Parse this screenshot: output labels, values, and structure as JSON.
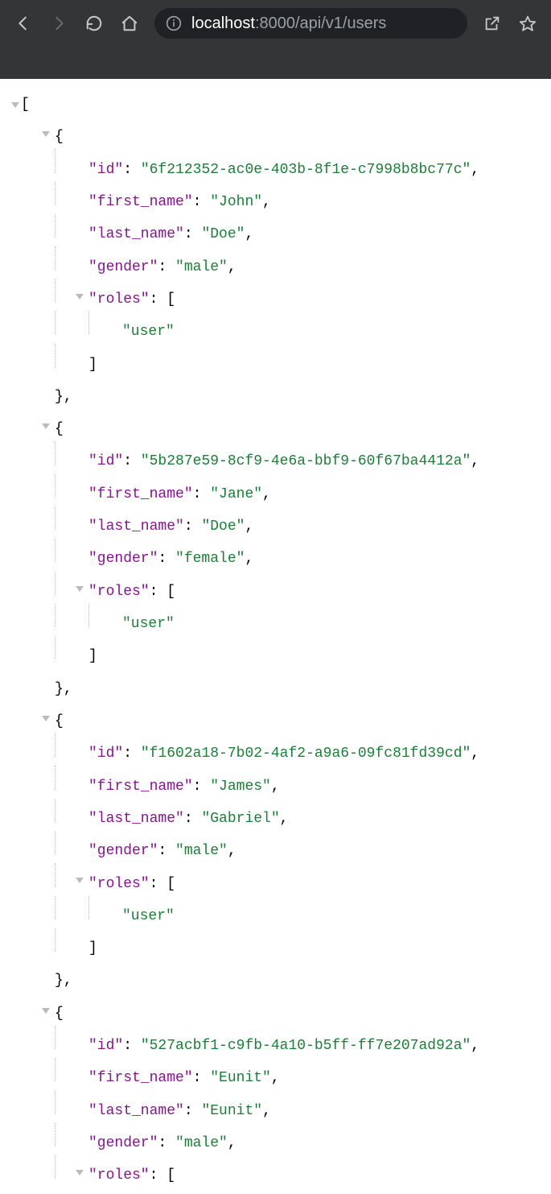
{
  "toolbar": {
    "url_host": "localhost",
    "url_port_path": ":8000/api/v1/users"
  },
  "json": {
    "users": [
      {
        "id": "6f212352-ac0e-403b-8f1e-c7998b8bc77c",
        "first_name": "John",
        "last_name": "Doe",
        "gender": "male",
        "roles": [
          "user"
        ]
      },
      {
        "id": "5b287e59-8cf9-4e6a-bbf9-60f67ba4412a",
        "first_name": "Jane",
        "last_name": "Doe",
        "gender": "female",
        "roles": [
          "user"
        ]
      },
      {
        "id": "f1602a18-7b02-4af2-a9a6-09fc81fd39cd",
        "first_name": "James",
        "last_name": "Gabriel",
        "gender": "male",
        "roles": [
          "user"
        ]
      },
      {
        "id": "527acbf1-c9fb-4a10-b5ff-ff7e207ad92a",
        "first_name": "Eunit",
        "last_name": "Eunit",
        "gender": "male",
        "roles": []
      }
    ],
    "last_user_cutoff_after_key": "roles"
  }
}
